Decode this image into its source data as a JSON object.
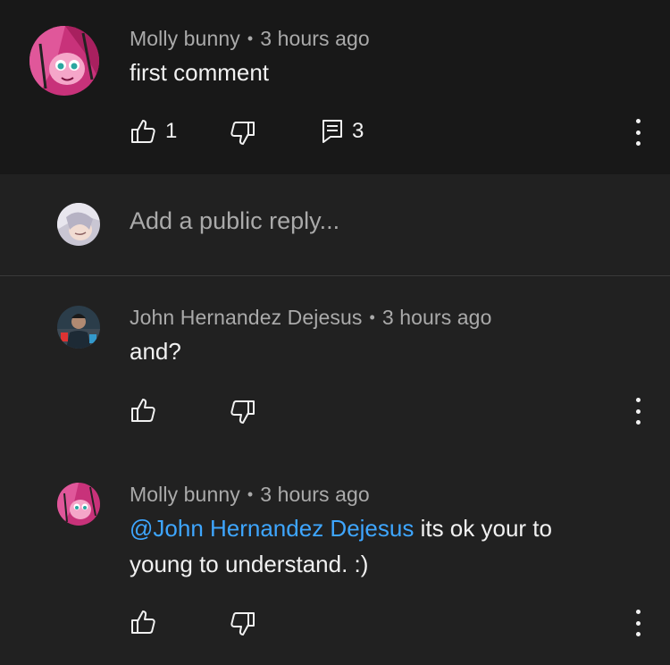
{
  "main_comment": {
    "author": "Molly bunny",
    "time": "3 hours ago",
    "text": "first comment",
    "likes": "1",
    "replies": "3"
  },
  "reply_box": {
    "placeholder": "Add a public reply..."
  },
  "replies": [
    {
      "author": "John Hernandez Dejesus",
      "time": "3 hours ago",
      "text": "and?"
    },
    {
      "author": "Molly bunny",
      "time": "3 hours ago",
      "mention": "@John Hernandez Dejesus",
      "text_line1": " its ok your to",
      "text_line2": "young to understand. :)"
    }
  ],
  "separator": "•",
  "icons": [
    "like-icon",
    "dislike-icon",
    "reply-icon",
    "more-options-icon",
    "avatar"
  ],
  "colors": {
    "background": "#212121",
    "highlight": "#181818",
    "mention": "#3ea6ff",
    "meta": "#aaaaaa",
    "text": "#f1f1f1"
  }
}
